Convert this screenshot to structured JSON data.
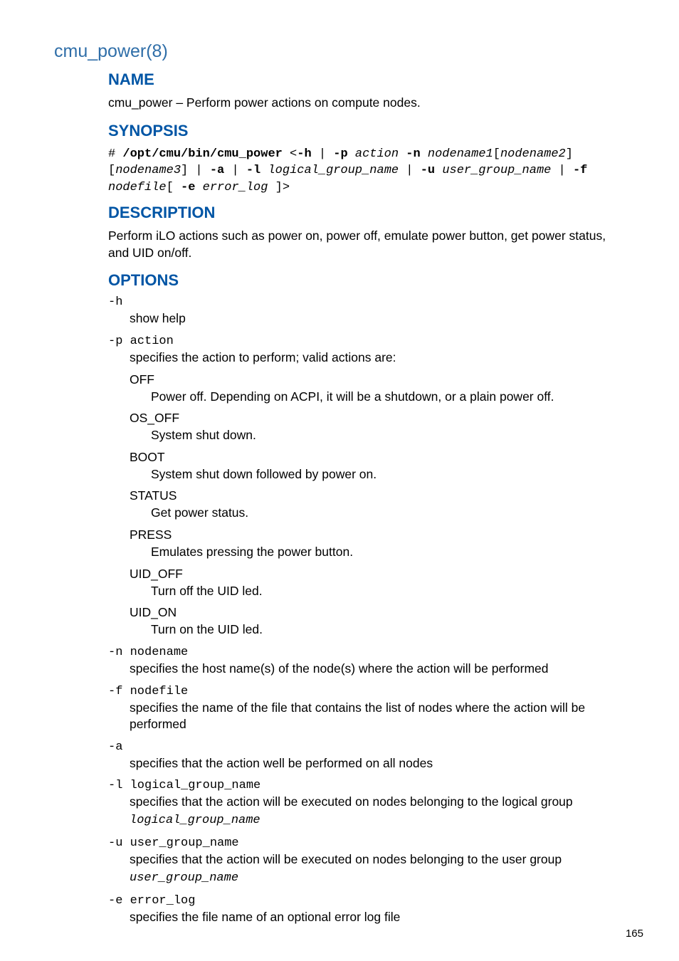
{
  "page_title": "cmu_power(8)",
  "sections": {
    "name": {
      "heading": "NAME",
      "text": "cmu_power – Perform power actions on compute nodes."
    },
    "synopsis": {
      "heading": "SYNOPSIS",
      "hash": "# ",
      "cmd": "/opt/cmu/bin/cmu_power",
      "lt": " <",
      "h": "-h",
      "pipe": " | ",
      "p": "-p",
      "sp": " ",
      "action": "action",
      "n": "-n",
      "node1": "nodename1",
      "lb": "[",
      "node2": "nodename2",
      "rb": "]",
      "node3": "nodename3",
      "a": "-a",
      "l": "-l",
      "lgn": "logical_group_name",
      "u": "-u",
      "ugn": "user_group_name",
      "f": "-f",
      "nodefile": "nodefile",
      "lbsp": "[ ",
      "e": "-e",
      "errlog": "error_log",
      "tail": " ]>"
    },
    "description": {
      "heading": "DESCRIPTION",
      "text": "Perform iLO actions such as power on, power off, emulate power button, get power status, and UID on/off."
    },
    "options": {
      "heading": "OPTIONS",
      "h": {
        "term": "-h",
        "desc": "show help"
      },
      "p": {
        "term": "-p action",
        "desc": "specifies the action to perform; valid actions are:",
        "actions": {
          "off": {
            "name": "OFF",
            "desc": "Power off. Depending on ACPI, it will be a shutdown, or a plain power off."
          },
          "os_off": {
            "name": "OS_OFF",
            "desc": "System shut down."
          },
          "boot": {
            "name": "BOOT",
            "desc": "System shut down followed by power on."
          },
          "status": {
            "name": "STATUS",
            "desc": "Get power status."
          },
          "press": {
            "name": "PRESS",
            "desc": "Emulates pressing the power button."
          },
          "uid_off": {
            "name": "UID_OFF",
            "desc": "Turn off the UID led."
          },
          "uid_on": {
            "name": "UID_ON",
            "desc": "Turn on the UID led."
          }
        }
      },
      "n": {
        "term": "-n nodename",
        "desc": "specifies the host name(s) of the node(s) where the action will be performed"
      },
      "f": {
        "term": "-f nodefile",
        "desc": "specifies the name of the file that contains the list of nodes where the action will be performed"
      },
      "a": {
        "term": "-a",
        "desc": "specifies that the action well be performed on all nodes"
      },
      "l": {
        "term": "-l logical_group_name",
        "desc": "specifies that the action will be executed on nodes belonging to the logical group ",
        "arg": "logical_group_name"
      },
      "u": {
        "term": "-u user_group_name",
        "desc": "specifies that the action will be executed on nodes belonging to the user group ",
        "arg": "user_group_name"
      },
      "e": {
        "term": "-e error_log",
        "desc": "specifies the file name of an optional error log file"
      }
    }
  },
  "page_number": "165"
}
